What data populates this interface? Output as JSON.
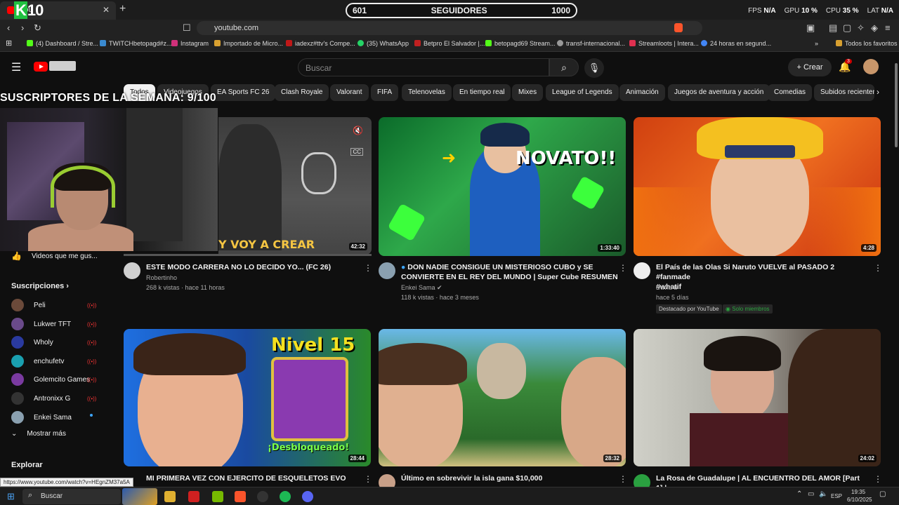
{
  "browser": {
    "tab_title": "You",
    "address": "youtube.com",
    "bookmarks": [
      "(4) Dashboard / Stre...",
      "TWITCHbetopagd#z...",
      "Instagram",
      "Importado de Micro...",
      "iadexz#ttv's Compe...",
      "(35) WhatsApp",
      "Betpro El Salvador |...",
      "betopagd69 Stream...",
      "transf-internacional...",
      "Streamloots | Intera...",
      "24 horas en segund..."
    ],
    "favorites": "Todos los favoritos",
    "status_url": "https://www.youtube.com/watch?v=HEgnZM37a5A"
  },
  "stream_overlay": {
    "counter": "10",
    "followers_current": "601",
    "followers_label": "SEGUIDORES",
    "followers_goal": "1000",
    "subs_text": "SUSCRIPTORES DE LA SEMANA: 9/100",
    "fps_label": "FPS",
    "fps_value": "N/A",
    "gpu_label": "GPU",
    "gpu_value": "10 %",
    "cpu_label": "CPU",
    "cpu_value": "35 %",
    "lat_label": "LAT",
    "lat_value": "N/A"
  },
  "youtube": {
    "search_placeholder": "Buscar",
    "create_label": "Crear",
    "notif_count": "3",
    "chips": [
      "Todos",
      "Videojuegos",
      "EA Sports FC 26",
      "Clash Royale",
      "Valorant",
      "FIFA",
      "Telenovelas",
      "En tiempo real",
      "Mixes",
      "League of Legends",
      "Animación",
      "Juegos de aventura y acción",
      "Comedias",
      "Subidos recientem"
    ],
    "sidebar": {
      "liked": "Videos que me gus...",
      "subs_heading": "Suscripciones",
      "subs": [
        {
          "name": "Peli",
          "live": true,
          "color": "#6b4a3a"
        },
        {
          "name": "Lukwer TFT",
          "live": true,
          "color": "#6a4a8a"
        },
        {
          "name": "Wholy",
          "live": true,
          "color": "#2a3aa0"
        },
        {
          "name": "enchufetv",
          "live": true,
          "color": "#1aa0b0"
        },
        {
          "name": "Golemcito Games",
          "live": true,
          "color": "#7a3aa0"
        },
        {
          "name": "Antronixx G",
          "live": true,
          "color": "#333333"
        },
        {
          "name": "Enkei Sama",
          "live": false,
          "color": "#8aa0b0"
        }
      ],
      "show_more": "Mostrar más",
      "explore": "Explorar"
    },
    "videos": [
      {
        "title": "ESTE MODO CARRERA NO LO DECIDO YO... (FC 26)",
        "title2": "",
        "channel": "Robertinho",
        "meta": "268 k vistas · hace 11 horas",
        "duration": "42:32",
        "thumb_text": "Y VOY A CREAR"
      },
      {
        "title": "DON NADIE CONSIGUE UN MISTERIOSO CUBO y SE",
        "title2": "CONVIERTE EN EL REY DEL MUNDO | Super Cube RESUMEN",
        "channel": "Enkei Sama",
        "meta": "118 k vistas · hace 3 meses",
        "duration": "1:33:40",
        "thumb_text": "NOVATO!!"
      },
      {
        "title": "El País de las Olas Si Naruto VUELVE al PASADO 2 #fanmade",
        "title2": "#whatif",
        "channel": "David b",
        "meta": "hace 5 días",
        "duration": "4:28",
        "badge1": "Destacado por YouTube",
        "badge2": "Solo miembros"
      },
      {
        "title": "MI PRIMERA VEZ CON EJERCITO DE ESQUELETOS EVO",
        "title2": "",
        "channel": "",
        "meta": "",
        "duration": "28:44",
        "thumb_text": "Nivel 15",
        "thumb_text2": "¡Desbloqueado!"
      },
      {
        "title": "Último en sobrevivir la isla gana $10,000",
        "title2": "",
        "channel": "",
        "meta": "",
        "duration": "28:32"
      },
      {
        "title": "La Rosa de Guadalupe | AL ENCUENTRO DEL AMOR [Part 1] |",
        "title2": "",
        "channel": "",
        "meta": "",
        "duration": "24:02"
      }
    ]
  },
  "taskbar": {
    "search": "Buscar",
    "lang": "ESP",
    "time": "19:35",
    "date": "6/10/2025"
  }
}
